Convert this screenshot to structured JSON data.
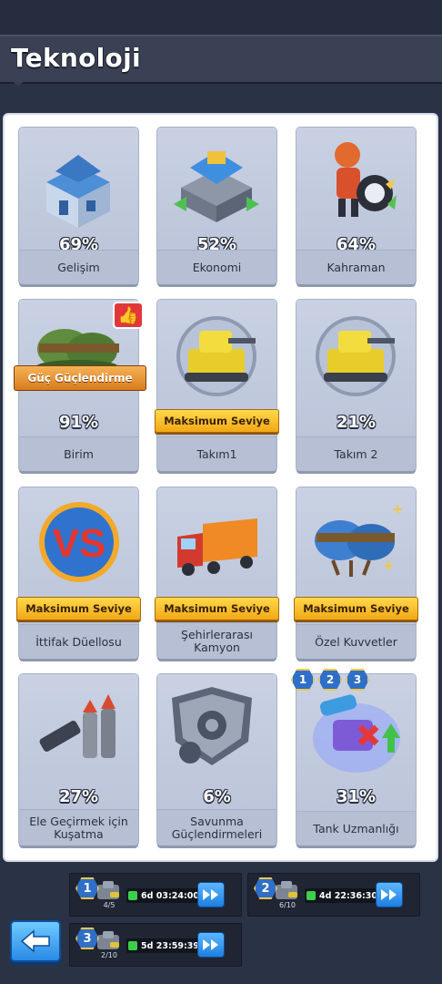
{
  "header": {
    "title": "Teknoloji"
  },
  "cards": [
    {
      "name": "Gelişim",
      "percent": "69%"
    },
    {
      "name": "Ekonomi",
      "percent": "52%"
    },
    {
      "name": "Kahraman",
      "percent": "64%"
    },
    {
      "name": "Birim",
      "percent": "91%",
      "ribbon": "Güç Güçlendirme"
    },
    {
      "name": "Takım1",
      "max_label": "Maksimum Seviye"
    },
    {
      "name": "Takım 2",
      "percent": "21%"
    },
    {
      "name": "İttifak Düellosu",
      "max_label": "Maksimum Seviye"
    },
    {
      "name": "Şehirlerarası Kamyon",
      "max_label": "Maksimum Seviye"
    },
    {
      "name": "Özel Kuvvetler",
      "max_label": "Maksimum Seviye"
    },
    {
      "name": "Ele Geçirmek için Kuşatma",
      "percent": "27%"
    },
    {
      "name": "Savunma Güçlendirmeleri",
      "percent": "6%"
    },
    {
      "name": "Tank Uzmanlığı",
      "percent": "31%",
      "badges": [
        "1",
        "2",
        "3"
      ]
    }
  ],
  "queues": [
    {
      "slot": "1",
      "count": "4/5",
      "timer": "6d 03:24:00"
    },
    {
      "slot": "2",
      "count": "6/10",
      "timer": "4d 22:36:30"
    },
    {
      "slot": "3",
      "count": "2/10",
      "timer": "5d 23:59:39"
    }
  ],
  "colors": {
    "accent_blue": "#2a8ae6",
    "max_gold": "#f2a816",
    "timer_green": "#3ccf4a"
  }
}
